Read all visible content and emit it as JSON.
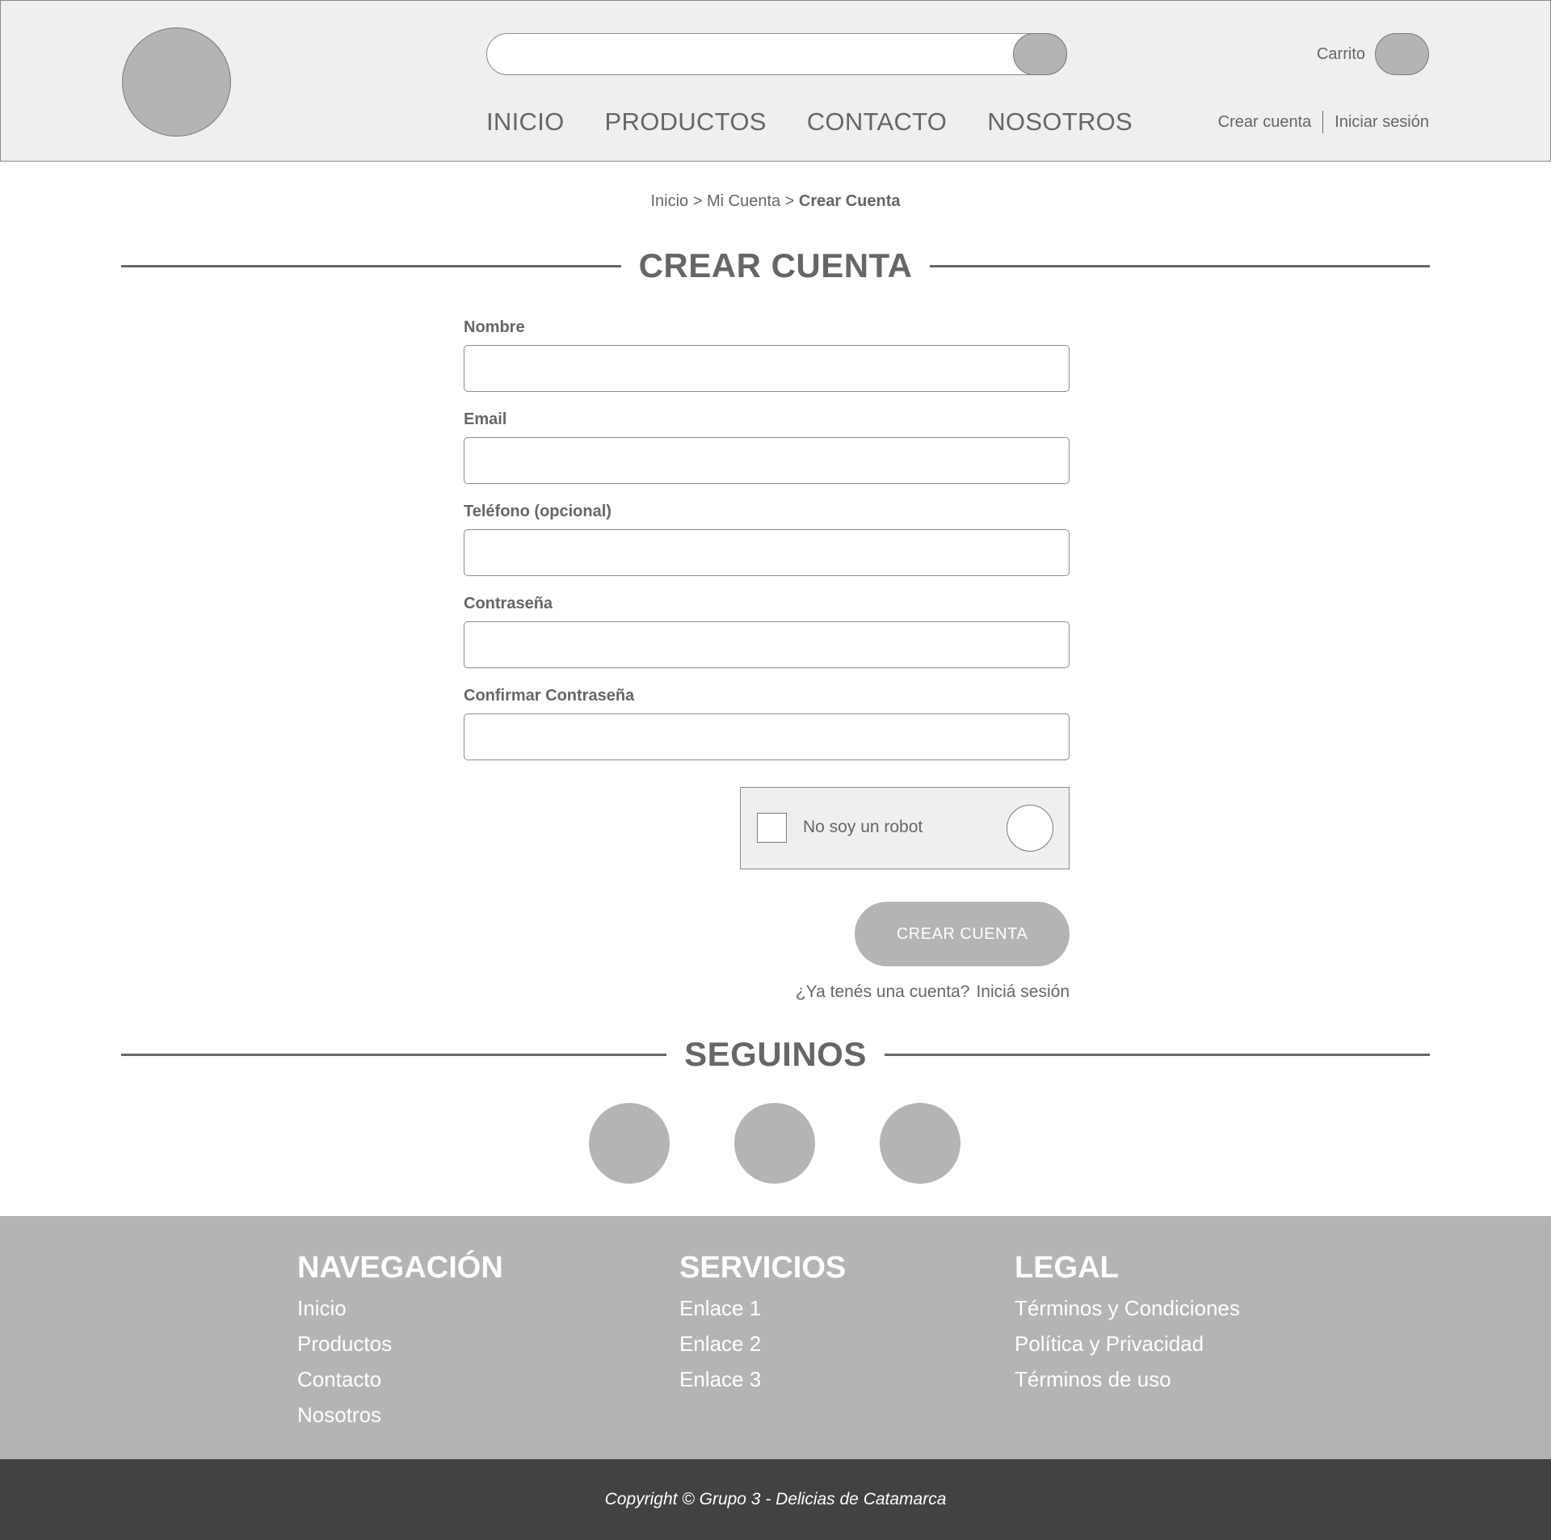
{
  "header": {
    "search_placeholder": "",
    "nav": [
      "INICIO",
      "PRODUCTOS",
      "CONTACTO",
      "NOSOTROS"
    ],
    "cart_label": "Carrito",
    "create_account": "Crear cuenta",
    "login": "Iniciar sesión"
  },
  "breadcrumb": {
    "home": "Inicio",
    "sep1": " > ",
    "account": "Mi Cuenta",
    "sep2": " > ",
    "current": "Crear Cuenta"
  },
  "page_title": "CREAR CUENTA",
  "form": {
    "fields": [
      {
        "label": "Nombre",
        "value": ""
      },
      {
        "label": "Email",
        "value": ""
      },
      {
        "label": "Teléfono (opcional)",
        "value": ""
      },
      {
        "label": "Contraseña",
        "value": ""
      },
      {
        "label": "Confirmar Contraseña",
        "value": ""
      }
    ],
    "captcha_label": "No soy un robot",
    "submit_label": "CREAR CUENTA",
    "have_account": "¿Ya tenés una cuenta?",
    "login_link": "Iniciá sesión"
  },
  "follow_title": "SEGUINOS",
  "footer": {
    "nav_title": "NAVEGACIÓN",
    "nav_links": [
      "Inicio",
      "Productos",
      "Contacto",
      "Nosotros"
    ],
    "services_title": "SERVICIOS",
    "services_links": [
      "Enlace 1",
      "Enlace 2",
      "Enlace 3"
    ],
    "legal_title": "LEGAL",
    "legal_links": [
      "Términos y Condiciones",
      "Política y Privacidad",
      "Términos de uso"
    ],
    "copyright": "Copyright © Grupo 3 - Delicias de Catamarca"
  },
  "colors": {
    "header_bg": "#efefef",
    "placeholder_gray": "#b4b4b4",
    "text_gray": "#666666",
    "copyright_bg": "#424242"
  }
}
